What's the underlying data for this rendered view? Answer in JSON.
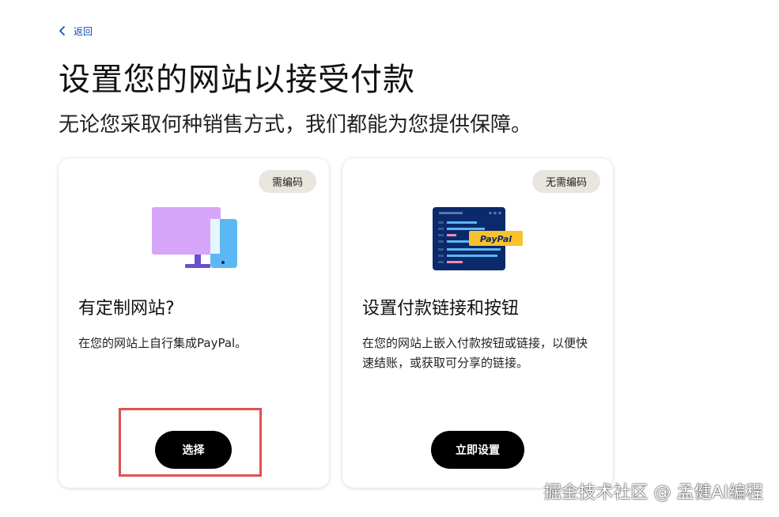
{
  "nav": {
    "back_label": "返回"
  },
  "header": {
    "title": "设置您的网站以接受付款",
    "subtitle": "无论您采取何种销售方式，我们都能为您提供保障。"
  },
  "cards": [
    {
      "badge": "需编码",
      "illustration": "monitor-phone-icon",
      "title": "有定制网站?",
      "description": "在您的网站上自行集成PayPal。",
      "button_label": "选择"
    },
    {
      "badge": "无需编码",
      "illustration": "code-window-paypal-icon",
      "illustration_text": "PayPal",
      "title": "设置付款链接和按钮",
      "description": "在您的网站上嵌入付款按钮或链接，以便快速结账，或获取可分享的链接。",
      "button_label": "立即设置"
    }
  ],
  "watermark": "掘金技术社区 @ 孟健AI编程",
  "colors": {
    "link": "#0a4fb4",
    "button_bg": "#000000",
    "badge_bg": "#e9e5df",
    "highlight_border": "#e05252",
    "monitor": "#d6a6fa",
    "phone": "#5cb8f5",
    "stand": "#6c4fc8",
    "code_bg": "#0b2a6b",
    "paypal_badge": "#f7c22e"
  }
}
